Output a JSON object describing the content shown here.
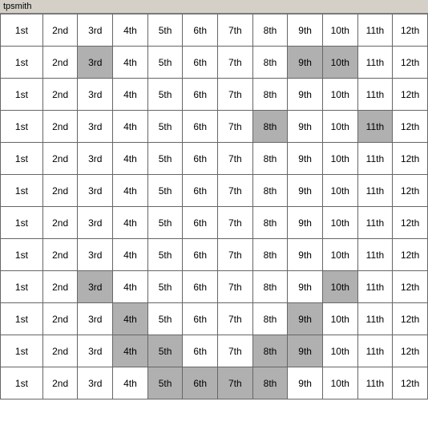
{
  "title": "tpsmith",
  "columns": [
    "1st",
    "2nd",
    "3rd",
    "4th",
    "5th",
    "6th",
    "7th",
    "8th",
    "9th",
    "10th",
    "11th",
    "12th"
  ],
  "rows": [
    {
      "cells": [
        {
          "text": "1st",
          "highlight": "none"
        },
        {
          "text": "2nd",
          "highlight": "none"
        },
        {
          "text": "3rd",
          "highlight": "none"
        },
        {
          "text": "4th",
          "highlight": "none"
        },
        {
          "text": "5th",
          "highlight": "none"
        },
        {
          "text": "6th",
          "highlight": "none"
        },
        {
          "text": "7th",
          "highlight": "none"
        },
        {
          "text": "8th",
          "highlight": "none"
        },
        {
          "text": "9th",
          "highlight": "none"
        },
        {
          "text": "10th",
          "highlight": "none"
        },
        {
          "text": "11th",
          "highlight": "none"
        },
        {
          "text": "12th",
          "highlight": "none"
        }
      ]
    },
    {
      "cells": [
        {
          "text": "1st",
          "highlight": "none"
        },
        {
          "text": "2nd",
          "highlight": "none"
        },
        {
          "text": "3rd",
          "highlight": "gray"
        },
        {
          "text": "4th",
          "highlight": "none"
        },
        {
          "text": "5th",
          "highlight": "none"
        },
        {
          "text": "6th",
          "highlight": "none"
        },
        {
          "text": "7th",
          "highlight": "none"
        },
        {
          "text": "8th",
          "highlight": "none"
        },
        {
          "text": "9th",
          "highlight": "gray"
        },
        {
          "text": "10th",
          "highlight": "gray"
        },
        {
          "text": "11th",
          "highlight": "none"
        },
        {
          "text": "12th",
          "highlight": "none"
        }
      ]
    },
    {
      "cells": [
        {
          "text": "1st",
          "highlight": "none"
        },
        {
          "text": "2nd",
          "highlight": "none"
        },
        {
          "text": "3rd",
          "highlight": "none"
        },
        {
          "text": "4th",
          "highlight": "none"
        },
        {
          "text": "5th",
          "highlight": "none"
        },
        {
          "text": "6th",
          "highlight": "none"
        },
        {
          "text": "7th",
          "highlight": "none"
        },
        {
          "text": "8th",
          "highlight": "none"
        },
        {
          "text": "9th",
          "highlight": "none"
        },
        {
          "text": "10th",
          "highlight": "none"
        },
        {
          "text": "11th",
          "highlight": "none"
        },
        {
          "text": "12th",
          "highlight": "none"
        }
      ]
    },
    {
      "cells": [
        {
          "text": "1st",
          "highlight": "none"
        },
        {
          "text": "2nd",
          "highlight": "none"
        },
        {
          "text": "3rd",
          "highlight": "none"
        },
        {
          "text": "4th",
          "highlight": "none"
        },
        {
          "text": "5th",
          "highlight": "none"
        },
        {
          "text": "6th",
          "highlight": "none"
        },
        {
          "text": "7th",
          "highlight": "none"
        },
        {
          "text": "8th",
          "highlight": "gray"
        },
        {
          "text": "9th",
          "highlight": "none"
        },
        {
          "text": "10th",
          "highlight": "none"
        },
        {
          "text": "11th",
          "highlight": "gray"
        },
        {
          "text": "12th",
          "highlight": "none"
        }
      ]
    },
    {
      "cells": [
        {
          "text": "1st",
          "highlight": "none"
        },
        {
          "text": "2nd",
          "highlight": "none"
        },
        {
          "text": "3rd",
          "highlight": "none"
        },
        {
          "text": "4th",
          "highlight": "none"
        },
        {
          "text": "5th",
          "highlight": "none"
        },
        {
          "text": "6th",
          "highlight": "none"
        },
        {
          "text": "7th",
          "highlight": "none"
        },
        {
          "text": "8th",
          "highlight": "none"
        },
        {
          "text": "9th",
          "highlight": "none"
        },
        {
          "text": "10th",
          "highlight": "none"
        },
        {
          "text": "11th",
          "highlight": "none"
        },
        {
          "text": "12th",
          "highlight": "none"
        }
      ]
    },
    {
      "cells": [
        {
          "text": "1st",
          "highlight": "none"
        },
        {
          "text": "2nd",
          "highlight": "none"
        },
        {
          "text": "3rd",
          "highlight": "none"
        },
        {
          "text": "4th",
          "highlight": "none"
        },
        {
          "text": "5th",
          "highlight": "none"
        },
        {
          "text": "6th",
          "highlight": "none"
        },
        {
          "text": "7th",
          "highlight": "none"
        },
        {
          "text": "8th",
          "highlight": "none"
        },
        {
          "text": "9th",
          "highlight": "none"
        },
        {
          "text": "10th",
          "highlight": "none"
        },
        {
          "text": "11th",
          "highlight": "none"
        },
        {
          "text": "12th",
          "highlight": "none"
        }
      ]
    },
    {
      "cells": [
        {
          "text": "1st",
          "highlight": "none"
        },
        {
          "text": "2nd",
          "highlight": "none"
        },
        {
          "text": "3rd",
          "highlight": "none"
        },
        {
          "text": "4th",
          "highlight": "none"
        },
        {
          "text": "5th",
          "highlight": "none"
        },
        {
          "text": "6th",
          "highlight": "none"
        },
        {
          "text": "7th",
          "highlight": "none"
        },
        {
          "text": "8th",
          "highlight": "none"
        },
        {
          "text": "9th",
          "highlight": "none"
        },
        {
          "text": "10th",
          "highlight": "none"
        },
        {
          "text": "11th",
          "highlight": "none"
        },
        {
          "text": "12th",
          "highlight": "none"
        }
      ]
    },
    {
      "cells": [
        {
          "text": "1st",
          "highlight": "none"
        },
        {
          "text": "2nd",
          "highlight": "none"
        },
        {
          "text": "3rd",
          "highlight": "none"
        },
        {
          "text": "4th",
          "highlight": "none"
        },
        {
          "text": "5th",
          "highlight": "none"
        },
        {
          "text": "6th",
          "highlight": "none"
        },
        {
          "text": "7th",
          "highlight": "none"
        },
        {
          "text": "8th",
          "highlight": "none"
        },
        {
          "text": "9th",
          "highlight": "none"
        },
        {
          "text": "10th",
          "highlight": "none"
        },
        {
          "text": "11th",
          "highlight": "none"
        },
        {
          "text": "12th",
          "highlight": "none"
        }
      ]
    },
    {
      "cells": [
        {
          "text": "1st",
          "highlight": "none"
        },
        {
          "text": "2nd",
          "highlight": "none"
        },
        {
          "text": "3rd",
          "highlight": "gray"
        },
        {
          "text": "4th",
          "highlight": "none"
        },
        {
          "text": "5th",
          "highlight": "none"
        },
        {
          "text": "6th",
          "highlight": "none"
        },
        {
          "text": "7th",
          "highlight": "none"
        },
        {
          "text": "8th",
          "highlight": "none"
        },
        {
          "text": "9th",
          "highlight": "none"
        },
        {
          "text": "10th",
          "highlight": "gray"
        },
        {
          "text": "11th",
          "highlight": "none"
        },
        {
          "text": "12th",
          "highlight": "none"
        }
      ]
    },
    {
      "cells": [
        {
          "text": "1st",
          "highlight": "none"
        },
        {
          "text": "2nd",
          "highlight": "none"
        },
        {
          "text": "3rd",
          "highlight": "none"
        },
        {
          "text": "4th",
          "highlight": "gray"
        },
        {
          "text": "5th",
          "highlight": "none"
        },
        {
          "text": "6th",
          "highlight": "none"
        },
        {
          "text": "7th",
          "highlight": "none"
        },
        {
          "text": "8th",
          "highlight": "none"
        },
        {
          "text": "9th",
          "highlight": "gray"
        },
        {
          "text": "10th",
          "highlight": "none"
        },
        {
          "text": "11th",
          "highlight": "none"
        },
        {
          "text": "12th",
          "highlight": "none"
        }
      ]
    },
    {
      "cells": [
        {
          "text": "1st",
          "highlight": "none"
        },
        {
          "text": "2nd",
          "highlight": "none"
        },
        {
          "text": "3rd",
          "highlight": "none"
        },
        {
          "text": "4th",
          "highlight": "gray"
        },
        {
          "text": "5th",
          "highlight": "gray"
        },
        {
          "text": "6th",
          "highlight": "none"
        },
        {
          "text": "7th",
          "highlight": "none"
        },
        {
          "text": "8th",
          "highlight": "gray"
        },
        {
          "text": "9th",
          "highlight": "gray"
        },
        {
          "text": "10th",
          "highlight": "none"
        },
        {
          "text": "11th",
          "highlight": "none"
        },
        {
          "text": "12th",
          "highlight": "none"
        }
      ]
    },
    {
      "cells": [
        {
          "text": "1st",
          "highlight": "none"
        },
        {
          "text": "2nd",
          "highlight": "none"
        },
        {
          "text": "3rd",
          "highlight": "none"
        },
        {
          "text": "4th",
          "highlight": "none"
        },
        {
          "text": "5th",
          "highlight": "gray"
        },
        {
          "text": "6th",
          "highlight": "gray"
        },
        {
          "text": "7th",
          "highlight": "gray"
        },
        {
          "text": "8th",
          "highlight": "gray"
        },
        {
          "text": "9th",
          "highlight": "none"
        },
        {
          "text": "10th",
          "highlight": "none"
        },
        {
          "text": "11th",
          "highlight": "none"
        },
        {
          "text": "12th",
          "highlight": "none"
        }
      ]
    }
  ]
}
